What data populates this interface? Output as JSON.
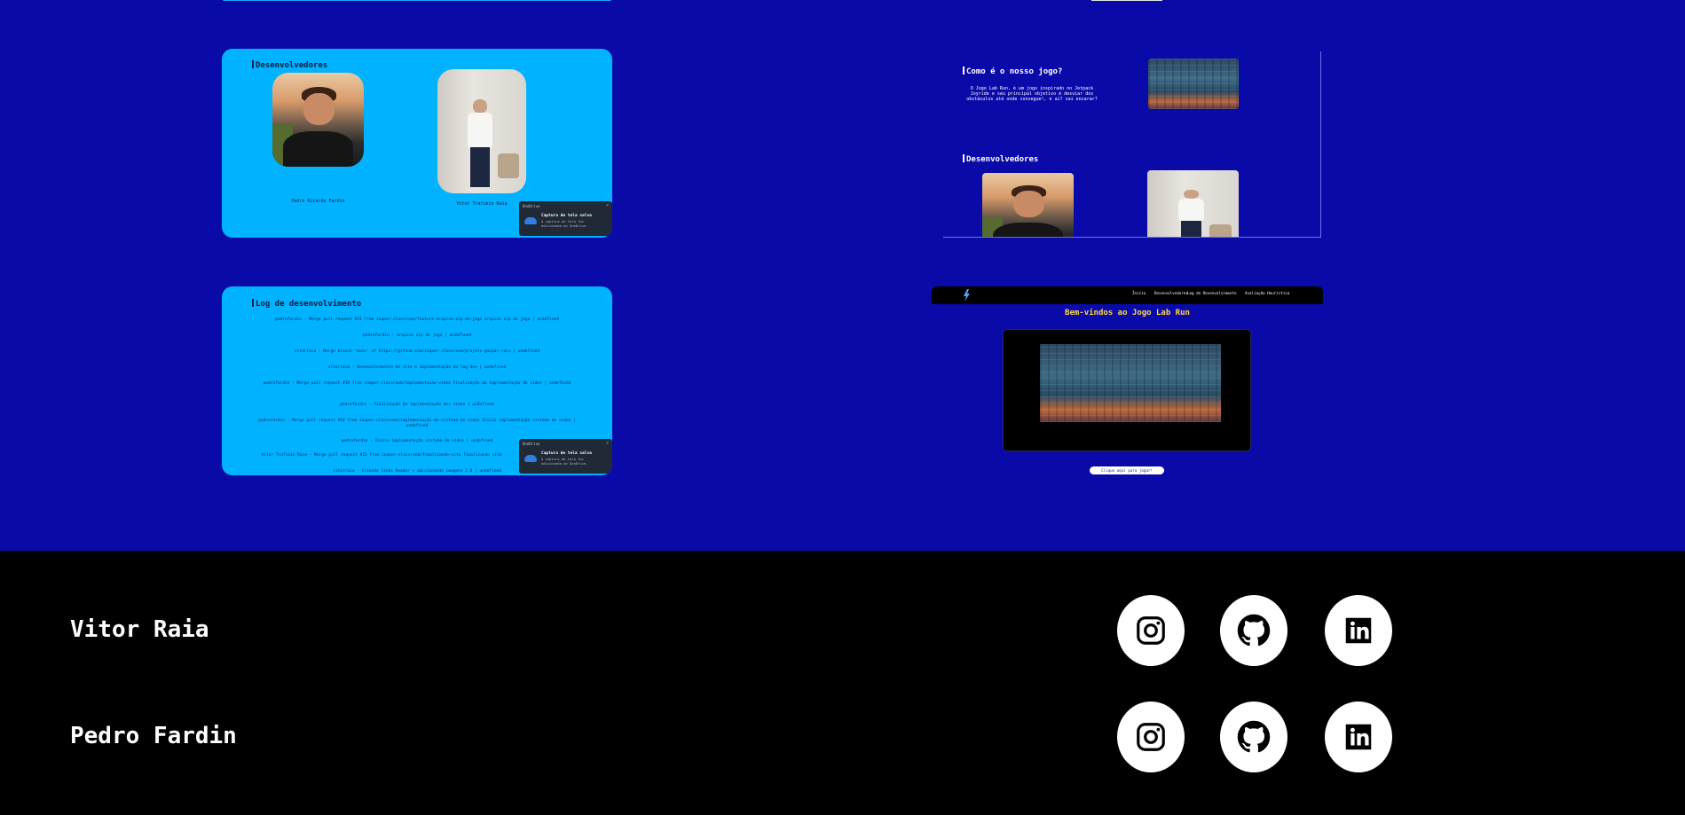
{
  "developers_card": {
    "title": "Desenvolvedores",
    "dev1_caption": "Pedro Ricardo Fardin",
    "dev2_caption": "Vitor Trafikin Raia"
  },
  "toast": {
    "app": "OneDrive",
    "title": "Captura de tela salva",
    "body": "A captura de tela foi adicionada ao OneDrive."
  },
  "log_card": {
    "title": "Log de desenvolvimento",
    "entries": [
      "pedrofardin - Merge pull request #21 from inaper-classroom/feature-arquivo-zip-do-jogo arquivo zip do jogo | undefined",
      "pedrofardin - arquivo zip do jogo | undefined",
      "vitorraia - Merge branch 'main' of https://github.com/inaper-classroom/projeto-gaspar-raia | undefined",
      "vitorraia - Desenvolvimento de site e implementação do log dev | undefined",
      "pedrofardin - Merge pull request #19 from inaper-classroom/implementacao-video finalização da implementação do vídeo | undefined",
      "pedrofardin - finalização da implementação dos vídeo | undefined",
      "pedrofardin - Merge pull request #18 from inaper-classroom/implementação-do-sistema-de-vídeo Inicio implementação sistema de vídeo | undefined",
      "pedrofardin - Inicio implementação sistema de vídeo | undefined",
      "Vitor Trafikin Raia - Merge pull request #15 from inaper-classroom/finalizando-site finalizando site",
      "vitorraia - Criando links Header + adicionando imagens 2.0 | undefined"
    ]
  },
  "game_card": {
    "title": "Como é o nosso jogo?",
    "description": "O Jogo Lab Run, é um jogo inspirado no Jetpack Joyride e seu principal objetivo é desviar dos obstáculos até onde consegue!, e aí? vai encarar?",
    "dev_title": "Desenvolvedores"
  },
  "site_preview": {
    "nav": [
      "Ínicio",
      "Desenvolvedores",
      "Log de Desenvolvimento",
      "Avaliação Heurística"
    ],
    "heading": "Bem-vindos ao Jogo Lab Run",
    "button": "Clique aqui para jogar!"
  },
  "footer": {
    "developers": [
      {
        "name": "Vitor Raia",
        "links": [
          "instagram-icon",
          "github-icon",
          "linkedin-icon"
        ]
      },
      {
        "name": "Pedro Fardin",
        "links": [
          "instagram-icon",
          "github-icon",
          "linkedin-icon"
        ]
      }
    ]
  },
  "colors": {
    "background_blue": "#0a0aa8",
    "card_cyan": "#00b2ff",
    "footer_black": "#000000",
    "heading_yellow": "#ffd84a"
  }
}
